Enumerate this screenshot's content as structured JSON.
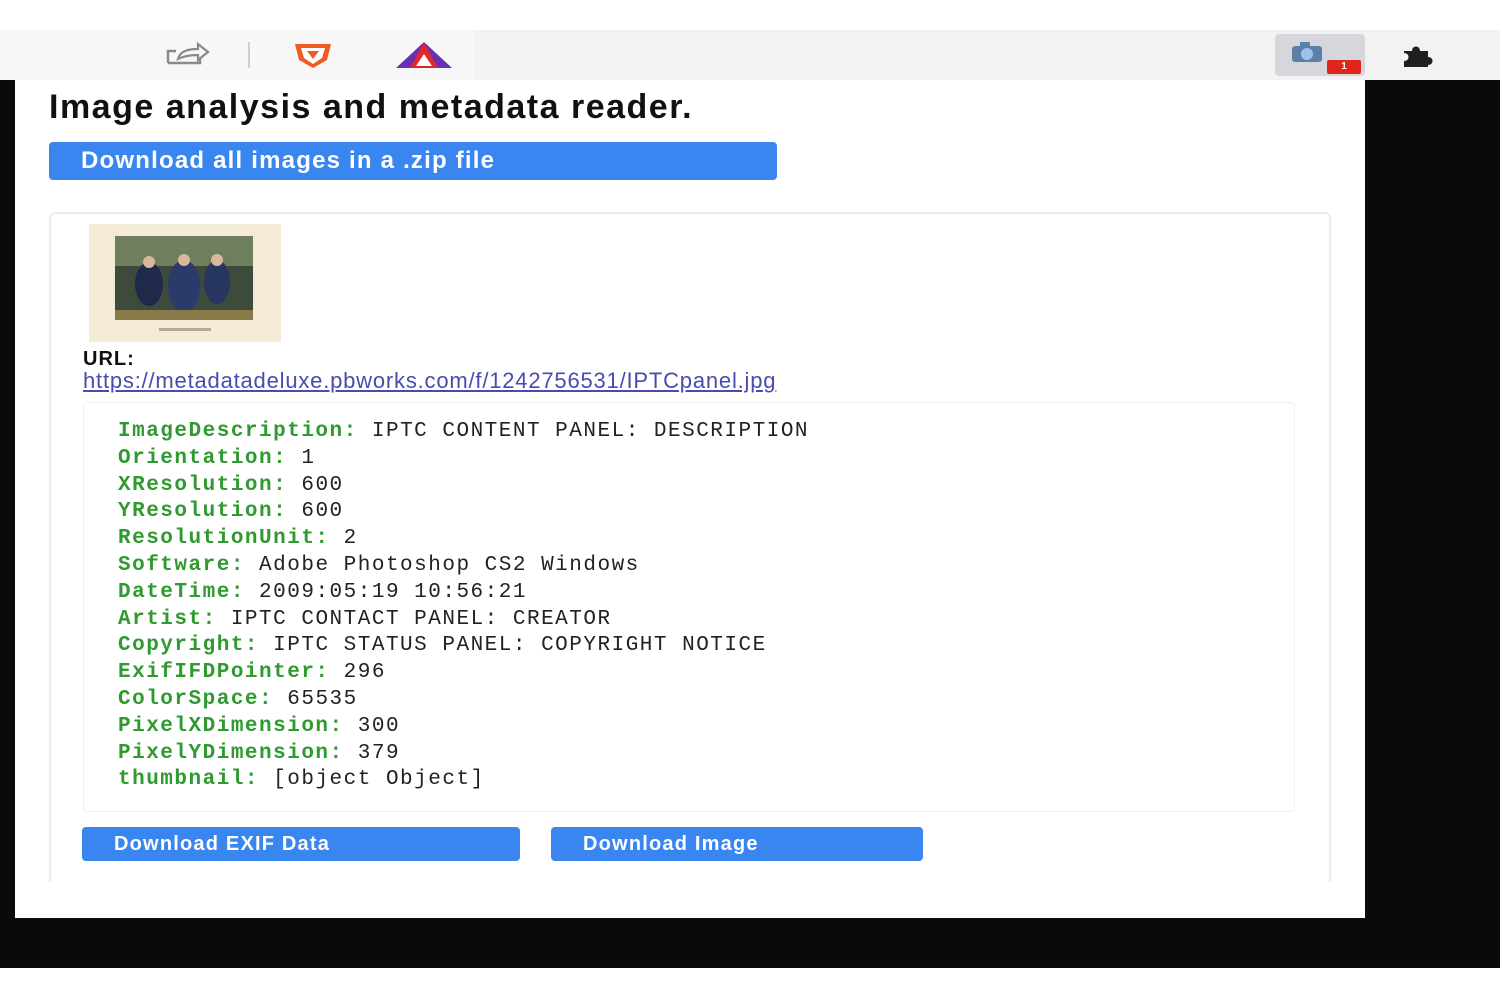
{
  "toolbar": {
    "icons": [
      "share-icon",
      "brave-shields-icon",
      "brave-rewards-icon",
      "image-analyzer-extension-icon",
      "puzzle-icon"
    ],
    "extension_badge": "1"
  },
  "popup": {
    "title": "Image analysis and metadata reader.",
    "download_zip_label": "Download all images in a .zip file",
    "url_label": "URL:",
    "url": "https://metadatadeluxe.pbworks.com/f/1242756531/IPTCpanel.jpg",
    "exif": [
      {
        "key": "ImageDescription:",
        "value": "IPTC CONTENT PANEL: DESCRIPTION"
      },
      {
        "key": "Orientation:",
        "value": "1"
      },
      {
        "key": "XResolution:",
        "value": "600"
      },
      {
        "key": "YResolution:",
        "value": "600"
      },
      {
        "key": "ResolutionUnit:",
        "value": "2"
      },
      {
        "key": "Software:",
        "value": "Adobe Photoshop CS2 Windows"
      },
      {
        "key": "DateTime:",
        "value": "2009:05:19 10:56:21"
      },
      {
        "key": "Artist:",
        "value": "IPTC CONTACT PANEL: CREATOR"
      },
      {
        "key": "Copyright:",
        "value": "IPTC STATUS PANEL: COPYRIGHT NOTICE"
      },
      {
        "key": "ExifIFDPointer:",
        "value": "296"
      },
      {
        "key": "ColorSpace:",
        "value": "65535"
      },
      {
        "key": "PixelXDimension:",
        "value": "300"
      },
      {
        "key": "PixelYDimension:",
        "value": "379"
      },
      {
        "key": "thumbnail:",
        "value": "[object Object]"
      }
    ],
    "download_exif_label": "Download EXIF Data",
    "download_image_label": "Download Image"
  },
  "colors": {
    "accent": "#3a86f0",
    "exif_key": "#2f9a2f",
    "link": "#4a4ab0"
  }
}
